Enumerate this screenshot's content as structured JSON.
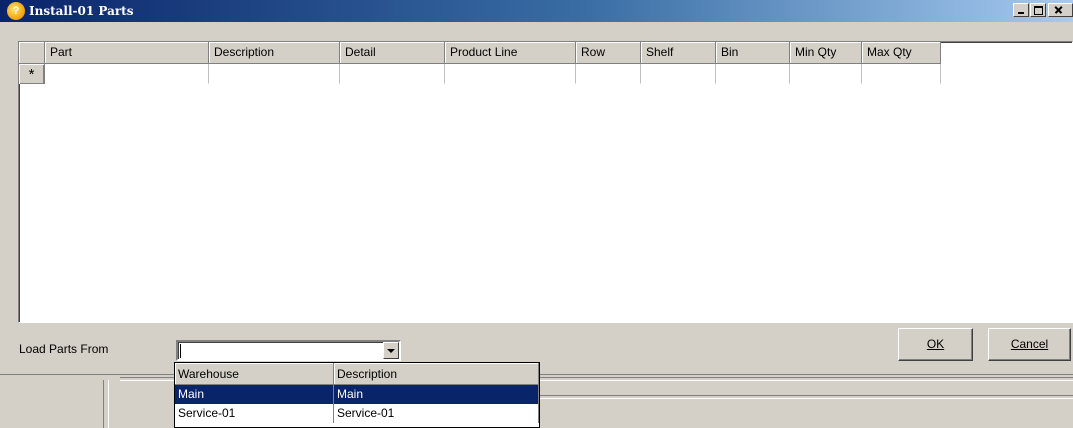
{
  "window": {
    "title": "Install-01 Parts"
  },
  "grid": {
    "columns": [
      "Part",
      "Description",
      "Detail",
      "Product Line",
      "Row",
      "Shelf",
      "Bin",
      "Min Qty",
      "Max Qty"
    ],
    "new_row_marker": "*"
  },
  "load_parts": {
    "label": "Load Parts From",
    "value": "",
    "dropdown": {
      "columns": [
        "Warehouse",
        "Description"
      ],
      "rows": [
        {
          "warehouse": "Main",
          "description": "Main",
          "selected": true
        },
        {
          "warehouse": "Service-01",
          "description": "Service-01",
          "selected": false
        }
      ]
    }
  },
  "buttons": {
    "ok": "OK",
    "cancel": "Cancel"
  },
  "colors": {
    "title_bar_start": "#0a246a",
    "selection": "#0a246a",
    "face": "#d4d0c8"
  },
  "icons": {
    "app": "app-icon",
    "minimize": "minimize-icon",
    "maximize": "maximize-icon",
    "close": "close-icon",
    "dropdown": "chevron-down-icon"
  }
}
